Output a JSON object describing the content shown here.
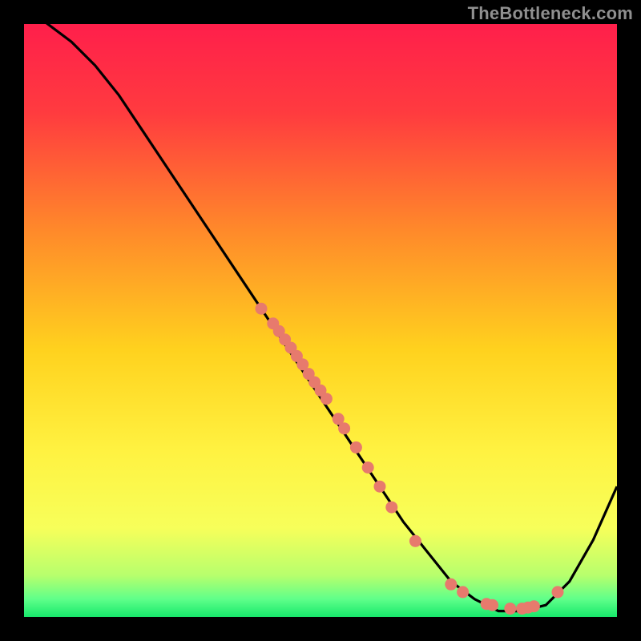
{
  "watermark": "TheBottleneck.com",
  "chart_data": {
    "type": "line",
    "title": "",
    "xlabel": "",
    "ylabel": "",
    "xlim": [
      0,
      100
    ],
    "ylim": [
      0,
      100
    ],
    "grid": false,
    "legend": false,
    "curve": {
      "x": [
        0,
        4,
        8,
        12,
        16,
        20,
        24,
        28,
        32,
        36,
        40,
        44,
        48,
        52,
        56,
        60,
        64,
        68,
        72,
        76,
        80,
        84,
        88,
        92,
        96,
        100
      ],
      "y": [
        103,
        100,
        97,
        93,
        88,
        82,
        76,
        70,
        64,
        58,
        52,
        46,
        40,
        34,
        28,
        22,
        16,
        11,
        6,
        3,
        1,
        1,
        2,
        6,
        13,
        22
      ]
    },
    "highlight_points": {
      "x": [
        40,
        42,
        43,
        44,
        45,
        46,
        47,
        48,
        49,
        50,
        51,
        53,
        54,
        56,
        58,
        60,
        62,
        66,
        72,
        74,
        78,
        79,
        82,
        84,
        85,
        86,
        90
      ],
      "y": [
        52,
        49.5,
        48.2,
        46.8,
        45.4,
        44,
        42.6,
        41,
        39.6,
        38.2,
        36.8,
        33.4,
        31.8,
        28.6,
        25.2,
        22,
        18.5,
        12.8,
        5.5,
        4.2,
        2.2,
        2,
        1.4,
        1.4,
        1.6,
        1.8,
        4.2
      ]
    },
    "gradient_stops": [
      {
        "offset": 0.0,
        "color": "#ff1f4b"
      },
      {
        "offset": 0.15,
        "color": "#ff3b3f"
      },
      {
        "offset": 0.35,
        "color": "#ff8a2a"
      },
      {
        "offset": 0.55,
        "color": "#ffd21e"
      },
      {
        "offset": 0.72,
        "color": "#fff241"
      },
      {
        "offset": 0.85,
        "color": "#f7ff5a"
      },
      {
        "offset": 0.93,
        "color": "#b7ff6d"
      },
      {
        "offset": 0.97,
        "color": "#5fff8a"
      },
      {
        "offset": 1.0,
        "color": "#17e86b"
      }
    ],
    "colors": {
      "curve": "#000000",
      "point": "#e77a6d",
      "background_frame": "#000000"
    }
  }
}
